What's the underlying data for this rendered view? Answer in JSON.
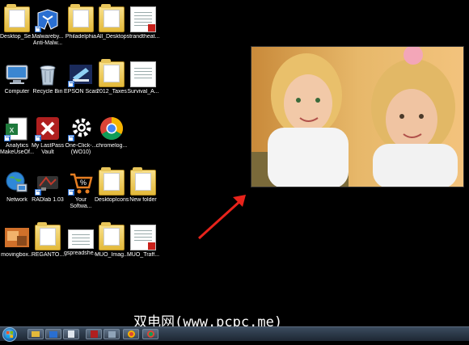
{
  "desktop": {
    "icons": [
      {
        "label": "Desktop_Se..."
      },
      {
        "label": "Malwareby... Anti-Malw..."
      },
      {
        "label": "Philadelphia"
      },
      {
        "label": "All_Desktop"
      },
      {
        "label": "strandtheat..."
      },
      {
        "label": "Computer"
      },
      {
        "label": "Recycle Bin"
      },
      {
        "label": "EPSON Scan"
      },
      {
        "label": "2012_Taxes"
      },
      {
        "label": "Survival_A..."
      },
      {
        "label": "Analytics MakeUseOf..."
      },
      {
        "label": "My LastPass Vault"
      },
      {
        "label": "One-Click-... (WO10)"
      },
      {
        "label": "chromelog..."
      },
      {
        "label": "Network"
      },
      {
        "label": "RADlab 1.03"
      },
      {
        "label": "Your Softwa..."
      },
      {
        "label": "DesktopIcons"
      },
      {
        "label": "New folder"
      },
      {
        "label": "movingbox..."
      },
      {
        "label": "REGANTO..."
      },
      {
        "label": "gspreadshe..."
      },
      {
        "label": "MUO_Imag..."
      },
      {
        "label": "MUO_Traff..."
      }
    ]
  },
  "watermark": "双电网(www.pcpc.me)",
  "colors": {
    "arrow": "#e8231b",
    "taskbar": "#2a3644",
    "desktop_bg": "#000000"
  }
}
